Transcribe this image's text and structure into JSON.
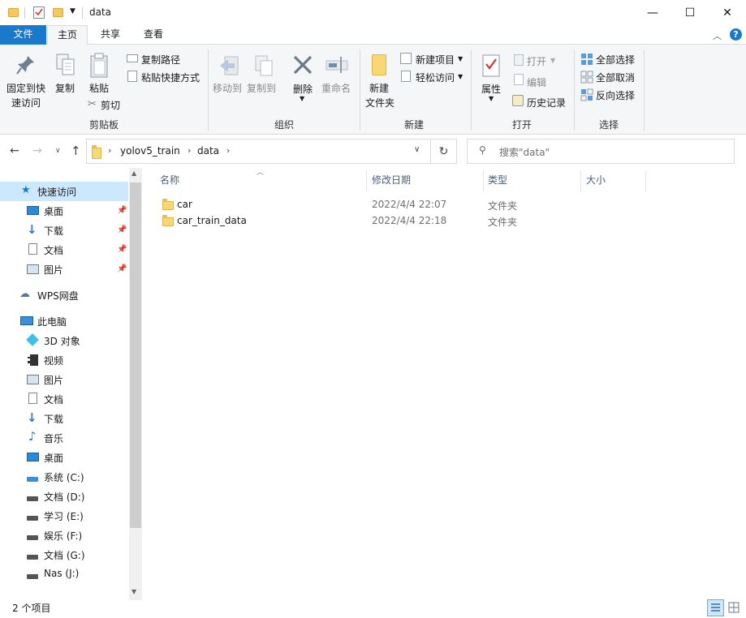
{
  "window": {
    "title": "data",
    "controls": {
      "minimize": "—",
      "maximize": "☐",
      "close": "✕"
    }
  },
  "tabs": [
    {
      "label": "文件"
    },
    {
      "label": "主页"
    },
    {
      "label": "共享"
    },
    {
      "label": "查看"
    }
  ],
  "ribbon": {
    "clipboard": {
      "pin_quick_access": "固定到快",
      "pin_quick_access_2": "速访问",
      "copy": "复制",
      "paste": "粘贴",
      "copy_path": "复制路径",
      "paste_shortcut": "粘贴快捷方式",
      "cut": "剪切",
      "label": "剪贴板"
    },
    "organize": {
      "move_to": "移动到",
      "copy_to": "复制到",
      "delete": "删除",
      "rename": "重命名",
      "label": "组织"
    },
    "new": {
      "new_folder": "新建",
      "new_folder_2": "文件夹",
      "new_item": "新建项目",
      "easy_access": "轻松访问",
      "label": "新建"
    },
    "open": {
      "properties": "属性",
      "open": "打开",
      "edit": "编辑",
      "history": "历史记录",
      "label": "打开"
    },
    "select": {
      "select_all": "全部选择",
      "select_none": "全部取消",
      "invert": "反向选择",
      "label": "选择"
    }
  },
  "address": {
    "crumbs": [
      "yolov5_train",
      "data"
    ],
    "search_placeholder": "搜索\"data\""
  },
  "nav": {
    "quick_access": "快速访问",
    "quick_items": [
      "桌面",
      "下载",
      "文档",
      "图片"
    ],
    "wps": "WPS网盘",
    "this_pc": "此电脑",
    "pc_items": [
      "3D 对象",
      "视频",
      "图片",
      "文档",
      "下载",
      "音乐",
      "桌面",
      "系统 (C:)",
      "文档 (D:)",
      "学习 (E:)",
      "娱乐 (F:)",
      "文档 (G:)",
      "Nas (J:)"
    ]
  },
  "columns": {
    "name": "名称",
    "modified": "修改日期",
    "type": "类型",
    "size": "大小"
  },
  "files": [
    {
      "name": "car",
      "modified": "2022/4/4 22:07",
      "type": "文件夹"
    },
    {
      "name": "car_train_data",
      "modified": "2022/4/4 22:18",
      "type": "文件夹"
    }
  ],
  "status": {
    "count": "2 个项目"
  }
}
